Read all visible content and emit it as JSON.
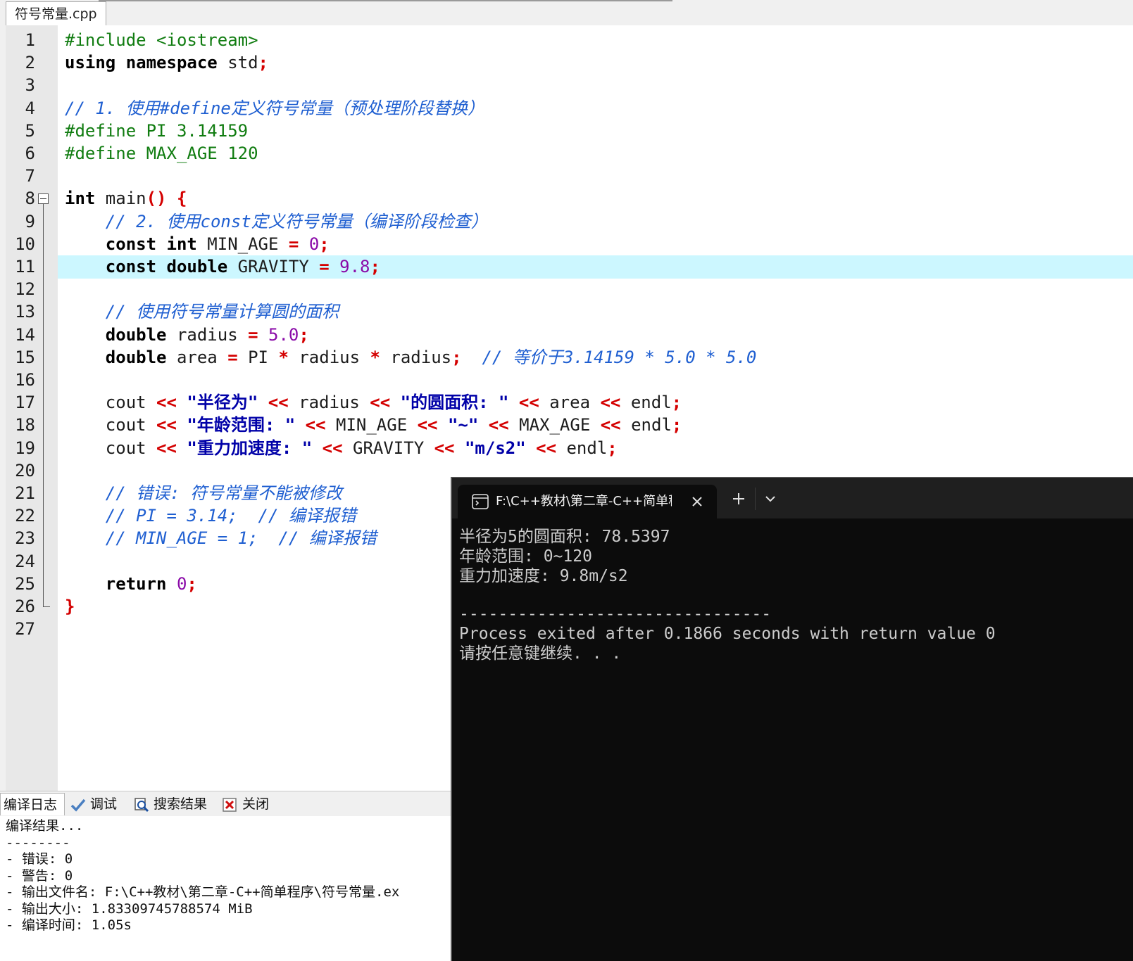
{
  "editor": {
    "file_tab": "符号常量.cpp",
    "current_line": 11,
    "lines": [
      [
        {
          "t": "#include <iostream>",
          "c": "pp"
        }
      ],
      [
        {
          "t": "using",
          "c": "kw"
        },
        {
          "t": " "
        },
        {
          "t": "namespace",
          "c": "kw"
        },
        {
          "t": " std"
        },
        {
          "t": ";",
          "c": "pn"
        }
      ],
      [],
      [
        {
          "t": "// 1. 使用#define定义符号常量（预处理阶段替换）",
          "c": "cm"
        }
      ],
      [
        {
          "t": "#define PI 3.14159",
          "c": "pp"
        }
      ],
      [
        {
          "t": "#define MAX_AGE 120",
          "c": "pp"
        }
      ],
      [],
      [
        {
          "t": "int",
          "c": "kw"
        },
        {
          "t": " main"
        },
        {
          "t": "()",
          "c": "pn"
        },
        {
          "t": " "
        },
        {
          "t": "{",
          "c": "pn"
        }
      ],
      [
        {
          "t": "    "
        },
        {
          "t": "// 2. 使用const定义符号常量（编译阶段检查）",
          "c": "cm"
        }
      ],
      [
        {
          "t": "    "
        },
        {
          "t": "const",
          "c": "kw"
        },
        {
          "t": " "
        },
        {
          "t": "int",
          "c": "kw"
        },
        {
          "t": " MIN_AGE "
        },
        {
          "t": "=",
          "c": "op"
        },
        {
          "t": " "
        },
        {
          "t": "0",
          "c": "num"
        },
        {
          "t": ";",
          "c": "pn"
        }
      ],
      [
        {
          "t": "    "
        },
        {
          "t": "const",
          "c": "kw"
        },
        {
          "t": " "
        },
        {
          "t": "double",
          "c": "kw"
        },
        {
          "t": " GRAVITY "
        },
        {
          "t": "=",
          "c": "op"
        },
        {
          "t": " "
        },
        {
          "t": "9.8",
          "c": "num"
        },
        {
          "t": ";",
          "c": "pn"
        }
      ],
      [],
      [
        {
          "t": "    "
        },
        {
          "t": "// 使用符号常量计算圆的面积",
          "c": "cm"
        }
      ],
      [
        {
          "t": "    "
        },
        {
          "t": "double",
          "c": "kw"
        },
        {
          "t": " radius "
        },
        {
          "t": "=",
          "c": "op"
        },
        {
          "t": " "
        },
        {
          "t": "5.0",
          "c": "num"
        },
        {
          "t": ";",
          "c": "pn"
        }
      ],
      [
        {
          "t": "    "
        },
        {
          "t": "double",
          "c": "kw"
        },
        {
          "t": " area "
        },
        {
          "t": "=",
          "c": "op"
        },
        {
          "t": " PI "
        },
        {
          "t": "*",
          "c": "op"
        },
        {
          "t": " radius "
        },
        {
          "t": "*",
          "c": "op"
        },
        {
          "t": " radius"
        },
        {
          "t": ";",
          "c": "pn"
        },
        {
          "t": "  "
        },
        {
          "t": "// 等价于3.14159 * 5.0 * 5.0",
          "c": "cm"
        }
      ],
      [],
      [
        {
          "t": "    cout "
        },
        {
          "t": "<<",
          "c": "op"
        },
        {
          "t": " "
        },
        {
          "t": "\"半径为\"",
          "c": "str"
        },
        {
          "t": " "
        },
        {
          "t": "<<",
          "c": "op"
        },
        {
          "t": " radius "
        },
        {
          "t": "<<",
          "c": "op"
        },
        {
          "t": " "
        },
        {
          "t": "\"的圆面积: \"",
          "c": "str"
        },
        {
          "t": " "
        },
        {
          "t": "<<",
          "c": "op"
        },
        {
          "t": " area "
        },
        {
          "t": "<<",
          "c": "op"
        },
        {
          "t": " endl"
        },
        {
          "t": ";",
          "c": "pn"
        }
      ],
      [
        {
          "t": "    cout "
        },
        {
          "t": "<<",
          "c": "op"
        },
        {
          "t": " "
        },
        {
          "t": "\"年龄范围: \"",
          "c": "str"
        },
        {
          "t": " "
        },
        {
          "t": "<<",
          "c": "op"
        },
        {
          "t": " MIN_AGE "
        },
        {
          "t": "<<",
          "c": "op"
        },
        {
          "t": " "
        },
        {
          "t": "\"~\"",
          "c": "str"
        },
        {
          "t": " "
        },
        {
          "t": "<<",
          "c": "op"
        },
        {
          "t": " MAX_AGE "
        },
        {
          "t": "<<",
          "c": "op"
        },
        {
          "t": " endl"
        },
        {
          "t": ";",
          "c": "pn"
        }
      ],
      [
        {
          "t": "    cout "
        },
        {
          "t": "<<",
          "c": "op"
        },
        {
          "t": " "
        },
        {
          "t": "\"重力加速度: \"",
          "c": "str"
        },
        {
          "t": " "
        },
        {
          "t": "<<",
          "c": "op"
        },
        {
          "t": " GRAVITY "
        },
        {
          "t": "<<",
          "c": "op"
        },
        {
          "t": " "
        },
        {
          "t": "\"m/s2\"",
          "c": "str"
        },
        {
          "t": " "
        },
        {
          "t": "<<",
          "c": "op"
        },
        {
          "t": " endl"
        },
        {
          "t": ";",
          "c": "pn"
        }
      ],
      [],
      [
        {
          "t": "    "
        },
        {
          "t": "// 错误: 符号常量不能被修改",
          "c": "cm"
        }
      ],
      [
        {
          "t": "    "
        },
        {
          "t": "// PI = 3.14;  // 编译报错",
          "c": "cm"
        }
      ],
      [
        {
          "t": "    "
        },
        {
          "t": "// MIN_AGE = 1;  // 编译报错",
          "c": "cm"
        }
      ],
      [],
      [
        {
          "t": "    "
        },
        {
          "t": "return",
          "c": "kw"
        },
        {
          "t": " "
        },
        {
          "t": "0",
          "c": "num"
        },
        {
          "t": ";",
          "c": "pn"
        }
      ],
      [
        {
          "t": "}",
          "c": "pn"
        }
      ],
      []
    ]
  },
  "bottom_panel": {
    "tabs": [
      {
        "label": "编译日志",
        "icon": "compile-log-icon",
        "active": true
      },
      {
        "label": "调试",
        "icon": "check-icon",
        "active": false
      },
      {
        "label": "搜索结果",
        "icon": "search-results-icon",
        "active": false
      },
      {
        "label": "关闭",
        "icon": "close-panel-icon",
        "active": false
      }
    ],
    "log_lines": [
      "编译结果...",
      "--------",
      "- 错误: 0",
      "- 警告: 0",
      "- 输出文件名: F:\\C++教材\\第二章-C++简单程序\\符号常量.ex",
      "- 输出大小: 1.83309745788574 MiB",
      "- 编译时间: 1.05s"
    ]
  },
  "terminal": {
    "tab_title": "F:\\C++教材\\第二章-C++简单程",
    "output": [
      "半径为5的圆面积: 78.5397",
      "年龄范围: 0~120",
      "重力加速度: 9.8m/s2",
      "",
      "--------------------------------",
      "Process exited after 0.1866 seconds with return value 0",
      "请按任意键继续. . ."
    ]
  }
}
